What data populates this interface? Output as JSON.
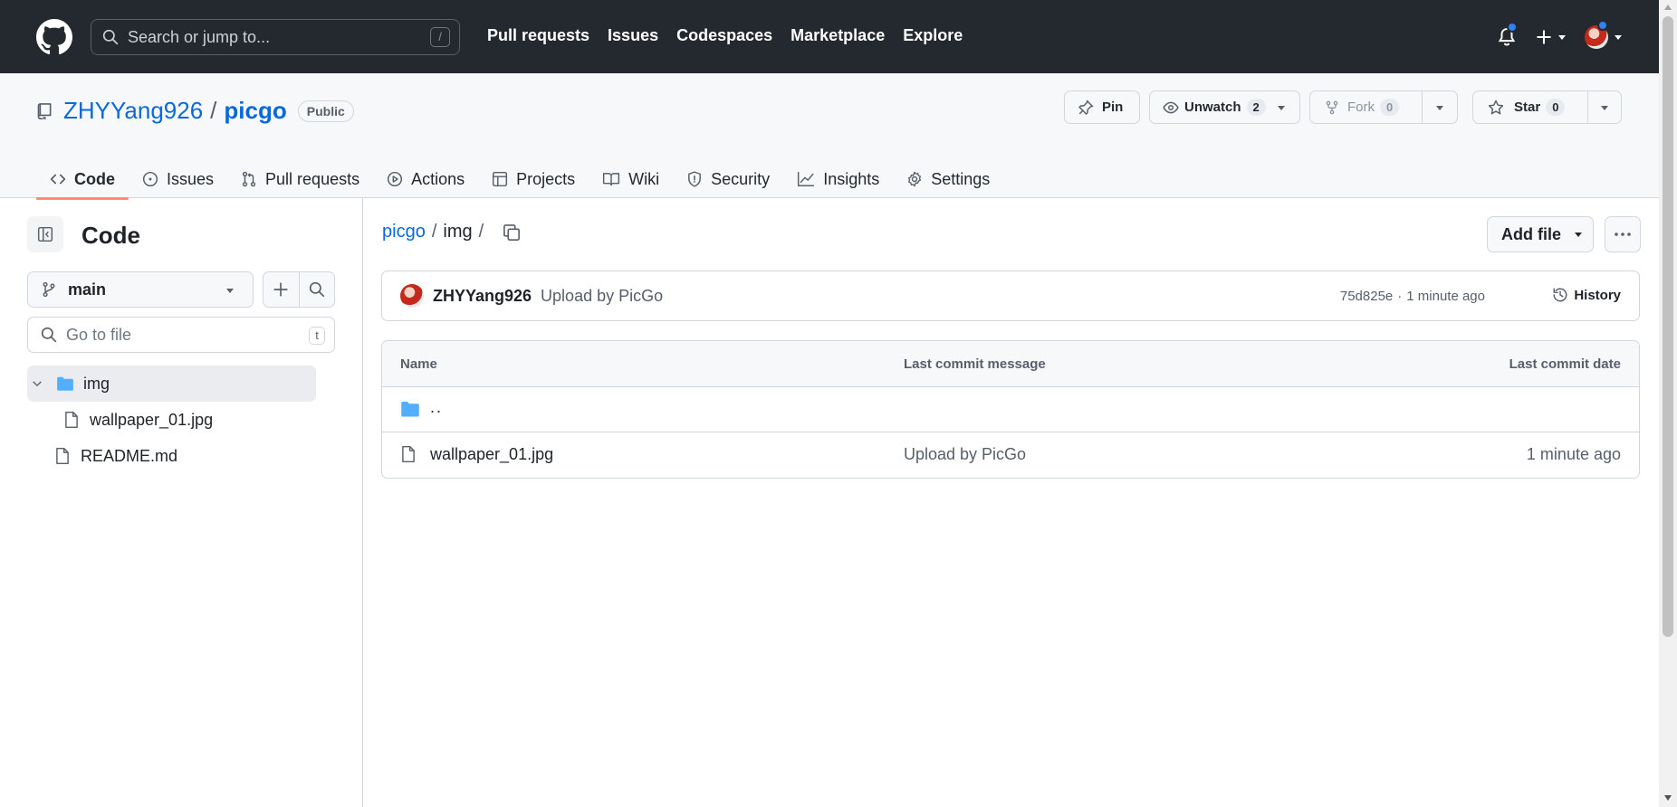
{
  "header": {
    "search_placeholder": "Search or jump to...",
    "search_shortcut": "/",
    "nav": [
      "Pull requests",
      "Issues",
      "Codespaces",
      "Marketplace",
      "Explore"
    ]
  },
  "repo": {
    "owner": "ZHYYang926",
    "separator": "/",
    "name": "picgo",
    "visibility": "Public",
    "pin_label": "Pin",
    "watch_label": "Unwatch",
    "watch_count": "2",
    "fork_label": "Fork",
    "fork_count": "0",
    "star_label": "Star",
    "star_count": "0"
  },
  "tabs": [
    {
      "label": "Code",
      "icon": "code-icon",
      "active": true
    },
    {
      "label": "Issues",
      "icon": "issue-opened-icon"
    },
    {
      "label": "Pull requests",
      "icon": "git-pull-request-icon"
    },
    {
      "label": "Actions",
      "icon": "play-icon"
    },
    {
      "label": "Projects",
      "icon": "table-icon"
    },
    {
      "label": "Wiki",
      "icon": "book-icon"
    },
    {
      "label": "Security",
      "icon": "shield-icon"
    },
    {
      "label": "Insights",
      "icon": "graph-icon"
    },
    {
      "label": "Settings",
      "icon": "gear-icon"
    }
  ],
  "sidebar": {
    "title": "Code",
    "branch": "main",
    "goto_placeholder": "Go to file",
    "goto_shortcut": "t",
    "tree": [
      {
        "label": "img",
        "type": "folder",
        "expanded": true,
        "selected": true
      },
      {
        "label": "wallpaper_01.jpg",
        "type": "file",
        "depth": 1
      },
      {
        "label": "README.md",
        "type": "file",
        "depth": 0
      }
    ]
  },
  "main": {
    "breadcrumb": {
      "root": "picgo",
      "current": "img",
      "sep": "/"
    },
    "add_file_label": "Add file",
    "latest_commit": {
      "author": "ZHYYang926",
      "message": "Upload by PicGo",
      "sha": "75d825e",
      "dot": "·",
      "time": "1 minute ago",
      "history_label": "History"
    },
    "table": {
      "columns": [
        "Name",
        "Last commit message",
        "Last commit date"
      ],
      "parent_row": "..",
      "rows": [
        {
          "name": "wallpaper_01.jpg",
          "message": "Upload by PicGo",
          "date": "1 minute ago"
        }
      ]
    }
  },
  "colors": {
    "header_bg": "#24292f",
    "link": "#0969da",
    "active_tab_underline": "#fd8c73",
    "folder": "#54aeff",
    "notification_dot": "#2f81f7"
  }
}
